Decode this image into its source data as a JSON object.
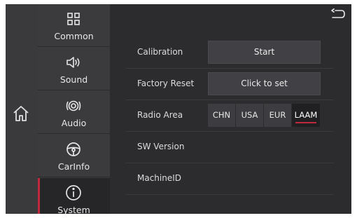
{
  "nav": {
    "items": [
      {
        "label": "Common",
        "icon": "grid-icon"
      },
      {
        "label": "Sound",
        "icon": "speaker-icon"
      },
      {
        "label": "Audio",
        "icon": "audio-rings-icon"
      },
      {
        "label": "CarInfo",
        "icon": "steering-wheel-icon"
      },
      {
        "label": "System",
        "icon": "info-icon",
        "active": true
      }
    ]
  },
  "settings": {
    "calibration": {
      "label": "Calibration",
      "button": "Start"
    },
    "factory_reset": {
      "label": "Factory Reset",
      "button": "Click to set"
    },
    "radio_area": {
      "label": "Radio Area",
      "options": [
        "CHN",
        "USA",
        "EUR",
        "LAAM"
      ],
      "selected": "LAAM"
    },
    "sw_version": {
      "label": "SW Version",
      "value": ""
    },
    "machine_id": {
      "label": "MachineID",
      "value": ""
    }
  },
  "colors": {
    "accent": "#c0283b",
    "background": "#2c2c2e"
  }
}
